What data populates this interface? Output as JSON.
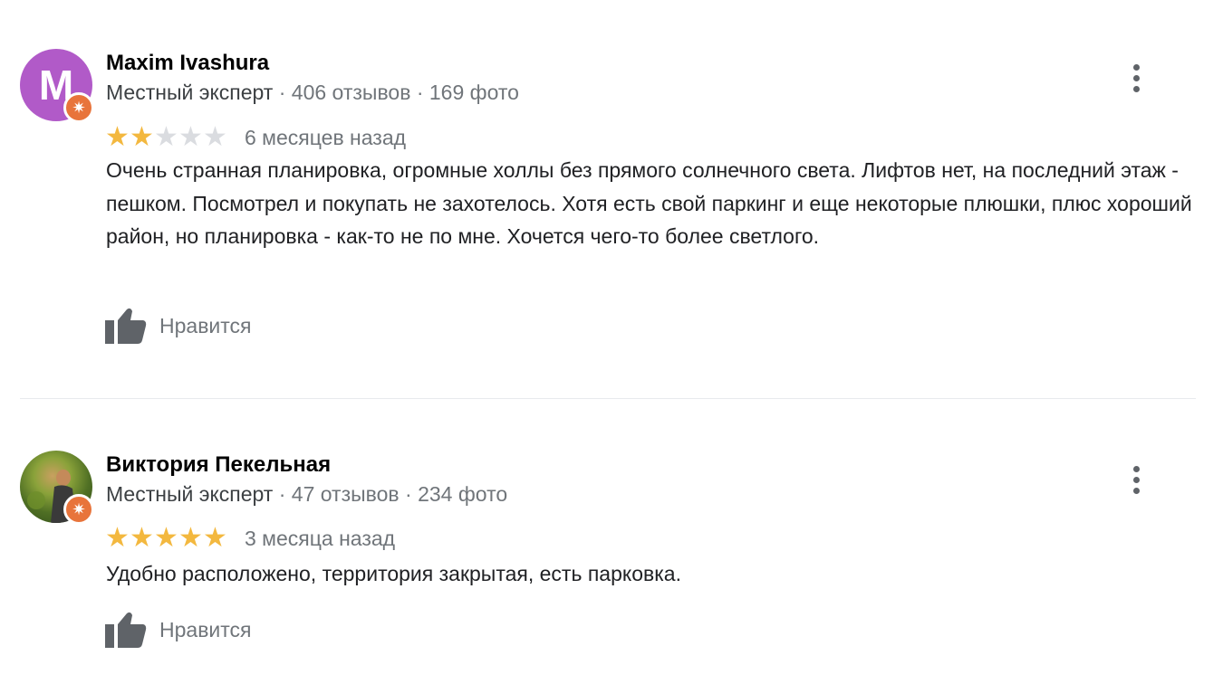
{
  "reviews": [
    {
      "avatar_letter": "M",
      "author": "Maxim Ivashura",
      "role": "Местный эксперт",
      "reviews_count": "406 отзывов",
      "photos_count": "169 фото",
      "rating": 2,
      "date": "6 месяцев назад",
      "text": "Очень странная планировка, огромные холлы без прямого солнечного света. Лифтов нет, на последний этаж - пешком. Посмотрел и покупать не захотелось. Хотя есть свой паркинг и еще некоторые плюшки, плюс хороший район, но планировка - как-то не по мне. Хочется чего-то более светлого.",
      "like_label": "Нравится"
    },
    {
      "avatar_letter": "",
      "author": "Виктория Пекельная",
      "role": "Местный эксперт",
      "reviews_count": "47 отзывов",
      "photos_count": "234 фото",
      "rating": 5,
      "date": "3 месяца назад",
      "text": "Удобно расположено, территория закрытая, есть парковка.",
      "like_label": "Нравится"
    }
  ],
  "separator": "·",
  "max_rating": 5,
  "colors": {
    "star_on": "#f3b83f",
    "star_off": "#dadce0",
    "badge": "#e8743b",
    "avatar_bg": "#b15ac8"
  },
  "icons": {
    "more": "more-vert-icon",
    "like": "thumb-up-icon",
    "badge": "local-guide-icon"
  }
}
